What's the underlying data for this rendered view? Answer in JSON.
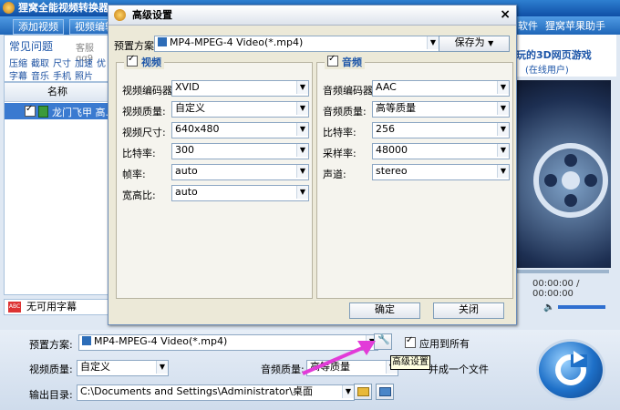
{
  "main_window": {
    "title": "狸窝全能视频转换器",
    "toolbar": {
      "add_video": "添加视频",
      "video_edit": "视频编辑",
      "software": "软件",
      "apple_helper": "狸窝苹果助手"
    }
  },
  "left_panel": {
    "faq_title": "常见问题",
    "faq_hint": "客服qq9",
    "faq_links_row1": [
      "压缩",
      "截取",
      "尺寸",
      "加速",
      "优"
    ],
    "faq_links_row2": [
      "字幕",
      "音乐",
      "手机",
      "照片"
    ],
    "list_header": "名称",
    "file_item": {
      "name": "龙门飞甲 高...",
      "checked": true
    },
    "subtitle": "无可用字幕"
  },
  "right_panel": {
    "promo_line1": "玩的3D网页游戏",
    "promo_line2": "(在线用户)",
    "time_readout": "00:00:00 / 00:00:00"
  },
  "bottom": {
    "preset_label": "预置方案:",
    "preset_value": "MP4-MPEG-4 Video(*.mp4)",
    "apply_all": "应用到所有",
    "apply_all_checked": true,
    "video_quality_label": "视频质量:",
    "video_quality_value": "自定义",
    "audio_quality_label": "音频质量:",
    "audio_quality_value": "高等质量",
    "merge_label": "并成一个文件",
    "output_label": "输出目录:",
    "output_value": "C:\\Documents and Settings\\Administrator\\桌面",
    "tooltip": "高级设置"
  },
  "dialog": {
    "title": "高级设置",
    "close": "×",
    "preset_label": "预置方案:",
    "preset_value": "MP4-MPEG-4 Video(*.mp4)",
    "save_as": "保存为",
    "video": {
      "title": "视频",
      "enabled": true,
      "fields": [
        {
          "label": "视频编码器:",
          "value": "XVID"
        },
        {
          "label": "视频质量:",
          "value": "自定义"
        },
        {
          "label": "视频尺寸:",
          "value": "640x480"
        },
        {
          "label": "比特率:",
          "value": "300"
        },
        {
          "label": "帧率:",
          "value": "auto"
        },
        {
          "label": "宽高比:",
          "value": "auto"
        }
      ]
    },
    "audio": {
      "title": "音频",
      "enabled": true,
      "fields": [
        {
          "label": "音频编码器:",
          "value": "AAC"
        },
        {
          "label": "音频质量:",
          "value": "高等质量"
        },
        {
          "label": "比特率:",
          "value": "256"
        },
        {
          "label": "采样率:",
          "value": "48000"
        },
        {
          "label": "声道:",
          "value": "stereo"
        }
      ]
    },
    "ok": "确定",
    "close_button": "关闭"
  },
  "colors": {
    "accent": "#1f66b8",
    "link": "#1a4fa0",
    "highlight": "#3a7ad0",
    "arrow": "#e23bd8"
  }
}
